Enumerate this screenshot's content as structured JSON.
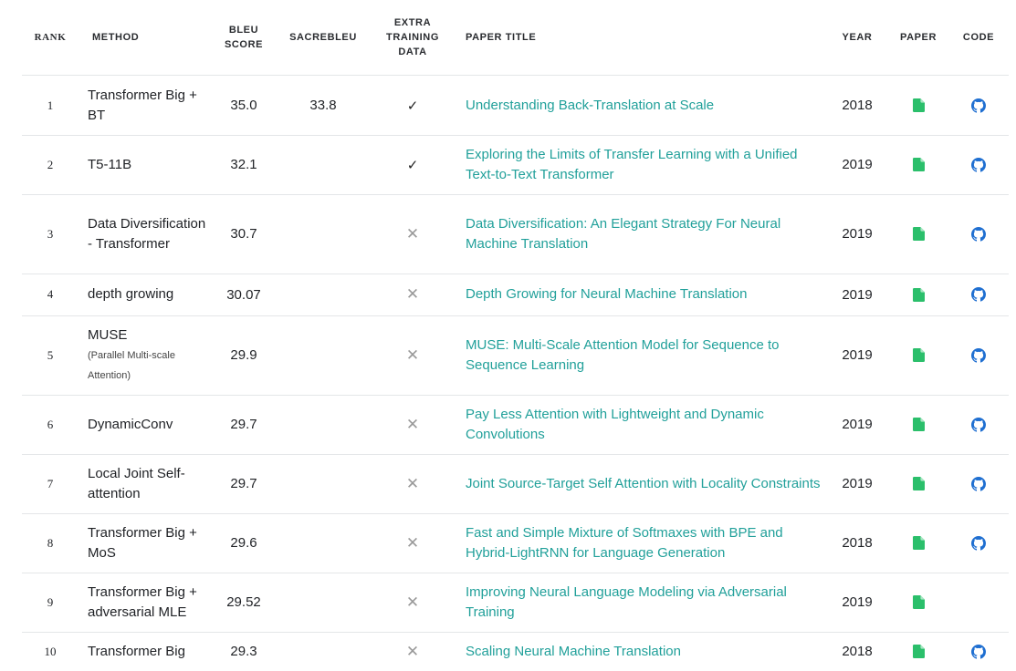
{
  "headers": {
    "rank": "RANK",
    "method": "METHOD",
    "bleu": [
      "BLEU",
      "SCORE"
    ],
    "sacrebleu": "SACREBLEU",
    "extra": [
      "EXTRA",
      "TRAINING",
      "DATA"
    ],
    "title": "PAPER TITLE",
    "year": "YEAR",
    "paper": "PAPER",
    "code": "CODE"
  },
  "colors": {
    "link": "#21a09a",
    "paper_icon": "#2bbf6b",
    "code_icon": "#1f6fd1"
  },
  "rows": [
    {
      "rank": "1",
      "method": "Transformer Big + BT",
      "method_sub": "",
      "bleu": "35.0",
      "sacrebleu": "33.8",
      "extra": "check",
      "title": "Understanding Back-Translation at Scale",
      "year": "2018",
      "paper": "file-icon",
      "code": "github-icon"
    },
    {
      "rank": "2",
      "method": "T5-11B",
      "method_sub": "",
      "bleu": "32.1",
      "sacrebleu": "",
      "extra": "check",
      "title": "Exploring the Limits of Transfer Learning with a Unified Text-to-Text Transformer",
      "year": "2019",
      "paper": "file-icon",
      "code": "github-icon"
    },
    {
      "rank": "3",
      "method": "Data Diversification - Transformer",
      "method_sub": "",
      "bleu": "30.7",
      "sacrebleu": "",
      "extra": "cross",
      "title": "Data Diversification: An Elegant Strategy For Neural Machine Translation",
      "year": "2019",
      "paper": "file-icon",
      "code": "github-icon"
    },
    {
      "rank": "4",
      "method": "depth growing",
      "method_sub": "",
      "bleu": "30.07",
      "sacrebleu": "",
      "extra": "cross",
      "title": "Depth Growing for Neural Machine Translation",
      "year": "2019",
      "paper": "file-icon",
      "code": "github-icon"
    },
    {
      "rank": "5",
      "method": "MUSE",
      "method_sub": "(Parallel Multi-scale Attention)",
      "bleu": "29.9",
      "sacrebleu": "",
      "extra": "cross",
      "title": "MUSE: Multi-Scale Attention Model for Sequence to Sequence Learning",
      "year": "2019",
      "paper": "file-icon",
      "code": "github-icon"
    },
    {
      "rank": "6",
      "method": "DynamicConv",
      "method_sub": "",
      "bleu": "29.7",
      "sacrebleu": "",
      "extra": "cross",
      "title": "Pay Less Attention with Lightweight and Dynamic Convolutions",
      "year": "2019",
      "paper": "file-icon",
      "code": "github-icon"
    },
    {
      "rank": "7",
      "method": "Local Joint Self-attention",
      "method_sub": "",
      "bleu": "29.7",
      "sacrebleu": "",
      "extra": "cross",
      "title": "Joint Source-Target Self Attention with Locality Constraints",
      "year": "2019",
      "paper": "file-icon",
      "code": "github-icon"
    },
    {
      "rank": "8",
      "method": "Transformer Big + MoS",
      "method_sub": "",
      "bleu": "29.6",
      "sacrebleu": "",
      "extra": "cross",
      "title": "Fast and Simple Mixture of Softmaxes with BPE and Hybrid-LightRNN for Language Generation",
      "year": "2018",
      "paper": "file-icon",
      "code": "github-icon"
    },
    {
      "rank": "9",
      "method": "Transformer Big + adversarial MLE",
      "method_sub": "",
      "bleu": "29.52",
      "sacrebleu": "",
      "extra": "cross",
      "title": "Improving Neural Language Modeling via Adversarial Training",
      "year": "2019",
      "paper": "file-icon",
      "code": ""
    },
    {
      "rank": "10",
      "method": "Transformer Big",
      "method_sub": "",
      "bleu": "29.3",
      "sacrebleu": "",
      "extra": "cross",
      "title": "Scaling Neural Machine Translation",
      "year": "2018",
      "paper": "file-icon",
      "code": "github-icon"
    }
  ]
}
